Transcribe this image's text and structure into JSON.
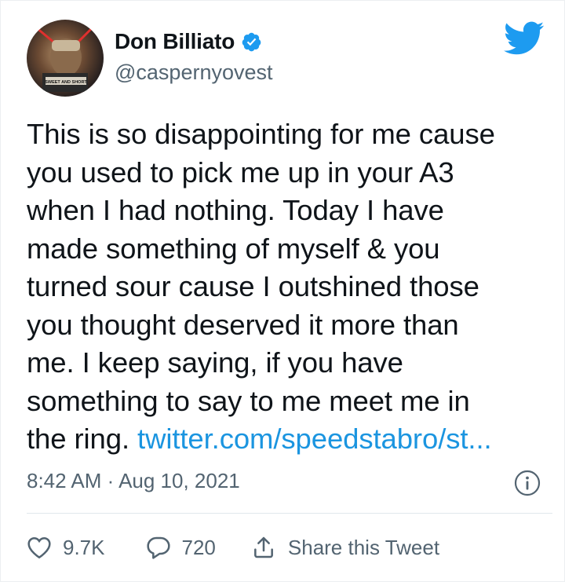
{
  "author": {
    "display_name": "Don Billiato",
    "handle": "@caspernyovest",
    "verified": true,
    "avatar_caption": "SWEET AND SHORT"
  },
  "tweet": {
    "lines": [
      "This is so disappointing for me cause",
      "you used to pick me up in your A3",
      "when I had nothing. Today I have",
      "made something of myself & you",
      "turned sour cause I outshined those",
      "you thought deserved it more than",
      "me. I keep saying, if you have",
      "something to say to me meet me in"
    ],
    "last_line_text": "the ring. ",
    "link": "twitter.com/speedstabro/st..."
  },
  "meta": {
    "timestamp": "8:42 AM · Aug 10, 2021"
  },
  "actions": {
    "like_count": "9.7K",
    "reply_count": "720",
    "share_label": "Share this Tweet"
  },
  "icons": {
    "brand": "twitter-bird-icon",
    "verified": "verified-badge-icon",
    "info": "info-icon",
    "like": "heart-icon",
    "reply": "reply-bubble-icon",
    "share": "share-icon"
  },
  "colors": {
    "brand_blue": "#1d9bf0",
    "link_blue": "#1b95e0",
    "muted_text": "#536471",
    "text": "#0f1419"
  }
}
